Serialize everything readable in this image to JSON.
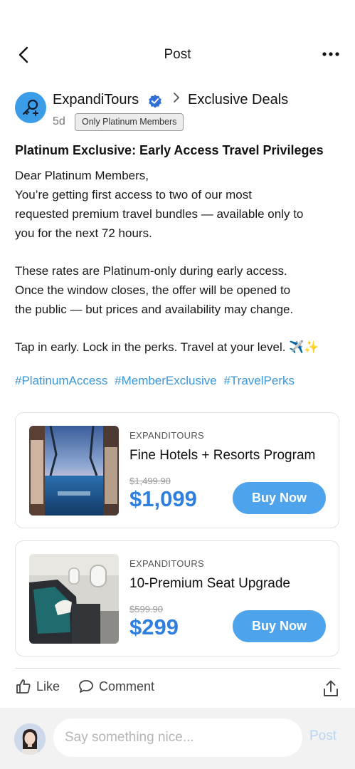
{
  "header": {
    "title": "Post"
  },
  "author": {
    "name": "ExpandiTours",
    "breadcrumb_target": "Exclusive Deals",
    "age": "5d",
    "audience_badge": "Only Platinum Members"
  },
  "post": {
    "title": "Platinum Exclusive: Early Access Travel Privileges",
    "body": [
      "Dear Platinum Members,",
      "You’re getting first access to two of our most",
      "requested premium travel bundles — available only to",
      "you for the next 72 hours.",
      "These rates are Platinum-only during early access.",
      "Once the window closes, the offer will be opened to",
      "the public — but prices and availability may change.",
      "Tap in early. Lock in the perks. Travel at your level. ✈️✨"
    ],
    "hashtags": [
      "#PlatinumAccess",
      "#MemberExclusive",
      "#TravelPerks"
    ]
  },
  "products": [
    {
      "brand": "EXPANDITOURS",
      "name": "Fine Hotels + Resorts Program",
      "original_price": "$1,499.90",
      "price": "$1,099",
      "cta": "Buy Now"
    },
    {
      "brand": "EXPANDITOURS",
      "name": "10-Premium Seat Upgrade",
      "original_price": "$599.90",
      "price": "$299",
      "cta": "Buy Now"
    }
  ],
  "actions": {
    "like": "Like",
    "comment": "Comment"
  },
  "comment_bar": {
    "placeholder": "Say something nice...",
    "send": "Post"
  },
  "colors": {
    "accent": "#2f80de",
    "button": "#4da3ec",
    "hashtag": "#3b96d6",
    "avatar_bg": "#3b9de8"
  }
}
